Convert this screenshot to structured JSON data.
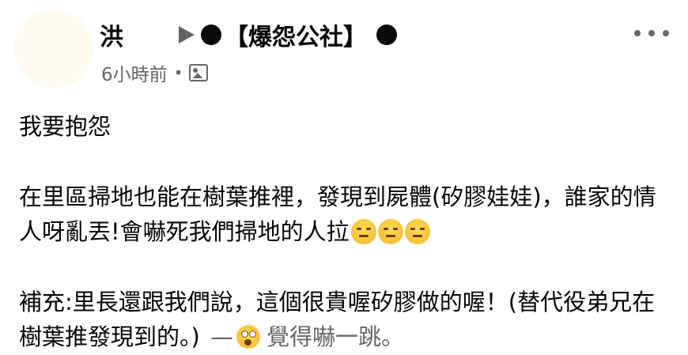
{
  "post": {
    "author": "洪",
    "group": "【爆怨公社】",
    "time": "6小時前",
    "meta_separator": "•",
    "body": {
      "line1": "我要抱怨",
      "para2": "在里區掃地也能在樹葉推裡，發現到屍體(矽膠娃娃)，誰家的情人呀亂丟!會嚇死我們掃地的人拉",
      "para3": "補充:里長還跟我們說，這個很貴喔矽膠做的喔！(替代役弟兄在樹葉推發現到的。)",
      "feeling_dash": "—",
      "feeling_text": "覺得嚇一跳。"
    },
    "icons": {
      "audience": "photo-icon",
      "more": "more-options-icon",
      "arrow": "share-arrow-icon",
      "expressionless": "expressionless-face-emoji",
      "feeling": "astonished-face-icon"
    }
  },
  "colors": {
    "text": "#050505",
    "secondary": "#65676b",
    "background": "#ffffff"
  }
}
